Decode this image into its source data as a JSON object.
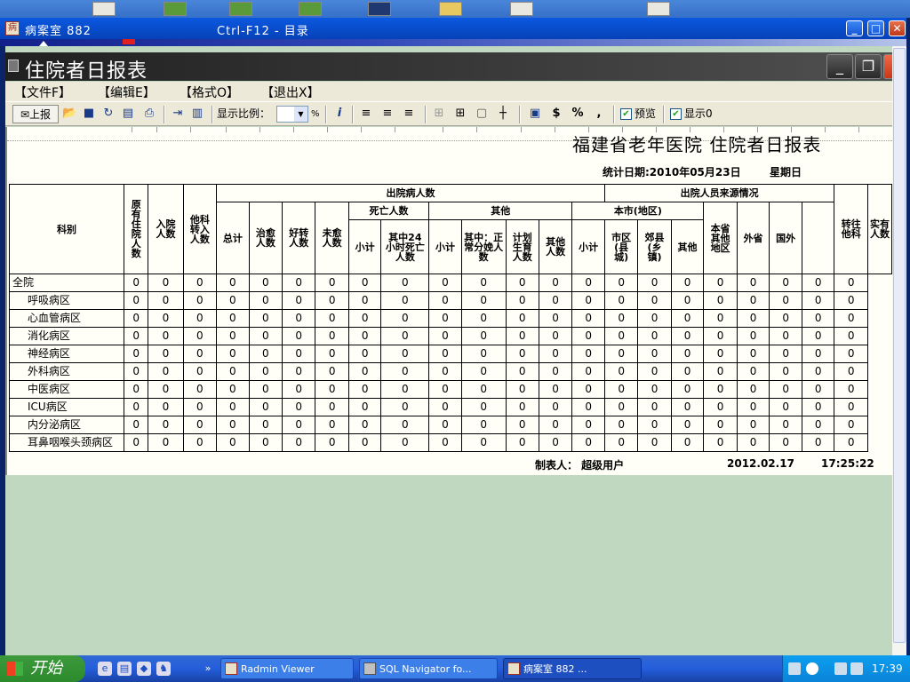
{
  "window": {
    "title": "病案室 882",
    "shortcut": "Ctrl-F12 - 目录"
  },
  "child": {
    "title": "住院者日报表"
  },
  "menu": {
    "file": "【文件F】",
    "edit": "【编辑E】",
    "format": "【格式O】",
    "exit": "【退出X】"
  },
  "toolbar": {
    "upload_label": "上报",
    "zoom_label": "显示比例：",
    "zoom_unit": "%",
    "preview_label": "预览",
    "show_label": "显示0",
    "dollar": "$",
    "percent": "%",
    "comma": ","
  },
  "report": {
    "title": "福建省老年医院  住院者日报表",
    "date": "统计日期:2010年05月23日",
    "weekday": "星期日",
    "headers": {
      "dept": "科别",
      "orig": "原有住院人数",
      "admit": "入院人数",
      "transfer_in": "他科转入人数",
      "discharge_group": "出院病人数",
      "total": "总计",
      "cured": "治愈人数",
      "improved": "好转人数",
      "not_cured": "未愈人数",
      "death_group": "死亡人数",
      "death_subtotal": "小计",
      "death_24h": "其中24小时死亡人数",
      "other_group": "其他",
      "other_subtotal": "小计",
      "normal_delivery": "其中：正常分娩人数",
      "planned_birth": "计划生育人数",
      "other_count": "其他人数",
      "source_group": "出院人员来源情况",
      "city_group": "本市(地区)",
      "city_subtotal": "小计",
      "city_district": "市区(县城)",
      "suburb": "郊县(乡镇)",
      "city_other": "其他",
      "province_other": "本省其他地区",
      "out_province": "外省",
      "abroad": "国外",
      "transfer_out": "转往他科",
      "actual": "实有人数"
    },
    "rows": [
      {
        "name": "全院",
        "top": true,
        "values": [
          "0",
          "0",
          "0",
          "0",
          "0",
          "0",
          "0",
          "0",
          "0",
          "0",
          "0",
          "0",
          "0",
          "0",
          "0",
          "0",
          "0",
          "0",
          "0",
          "0",
          "0",
          "0"
        ]
      },
      {
        "name": "呼吸病区",
        "values": [
          "0",
          "0",
          "0",
          "0",
          "0",
          "0",
          "0",
          "0",
          "0",
          "0",
          "0",
          "0",
          "0",
          "0",
          "0",
          "0",
          "0",
          "0",
          "0",
          "0",
          "0",
          "0"
        ]
      },
      {
        "name": "心血管病区",
        "values": [
          "0",
          "0",
          "0",
          "0",
          "0",
          "0",
          "0",
          "0",
          "0",
          "0",
          "0",
          "0",
          "0",
          "0",
          "0",
          "0",
          "0",
          "0",
          "0",
          "0",
          "0",
          "0"
        ]
      },
      {
        "name": "消化病区",
        "values": [
          "0",
          "0",
          "0",
          "0",
          "0",
          "0",
          "0",
          "0",
          "0",
          "0",
          "0",
          "0",
          "0",
          "0",
          "0",
          "0",
          "0",
          "0",
          "0",
          "0",
          "0",
          "0"
        ]
      },
      {
        "name": "神经病区",
        "values": [
          "0",
          "0",
          "0",
          "0",
          "0",
          "0",
          "0",
          "0",
          "0",
          "0",
          "0",
          "0",
          "0",
          "0",
          "0",
          "0",
          "0",
          "0",
          "0",
          "0",
          "0",
          "0"
        ]
      },
      {
        "name": "外科病区",
        "values": [
          "0",
          "0",
          "0",
          "0",
          "0",
          "0",
          "0",
          "0",
          "0",
          "0",
          "0",
          "0",
          "0",
          "0",
          "0",
          "0",
          "0",
          "0",
          "0",
          "0",
          "0",
          "0"
        ]
      },
      {
        "name": "中医病区",
        "values": [
          "0",
          "0",
          "0",
          "0",
          "0",
          "0",
          "0",
          "0",
          "0",
          "0",
          "0",
          "0",
          "0",
          "0",
          "0",
          "0",
          "0",
          "0",
          "0",
          "0",
          "0",
          "0"
        ]
      },
      {
        "name": "ICU病区",
        "values": [
          "0",
          "0",
          "0",
          "0",
          "0",
          "0",
          "0",
          "0",
          "0",
          "0",
          "0",
          "0",
          "0",
          "0",
          "0",
          "0",
          "0",
          "0",
          "0",
          "0",
          "0",
          "0"
        ]
      },
      {
        "name": "内分泌病区",
        "values": [
          "0",
          "0",
          "0",
          "0",
          "0",
          "0",
          "0",
          "0",
          "0",
          "0",
          "0",
          "0",
          "0",
          "0",
          "0",
          "0",
          "0",
          "0",
          "0",
          "0",
          "0",
          "0"
        ]
      },
      {
        "name": "耳鼻咽喉头颈病区",
        "values": [
          "0",
          "0",
          "0",
          "0",
          "0",
          "0",
          "0",
          "0",
          "0",
          "0",
          "0",
          "0",
          "0",
          "0",
          "0",
          "0",
          "0",
          "0",
          "0",
          "0",
          "0",
          "0"
        ]
      }
    ],
    "maker": "制表人： 超级用户",
    "print_date": "2012.02.17",
    "print_time": "17:25:22"
  },
  "taskbar": {
    "start": "开始",
    "tasks": [
      {
        "label": "Radmin Viewer"
      },
      {
        "label": "SQL Navigator fo..."
      },
      {
        "label": "病案室 882       ..."
      }
    ],
    "clock": "17:39"
  }
}
